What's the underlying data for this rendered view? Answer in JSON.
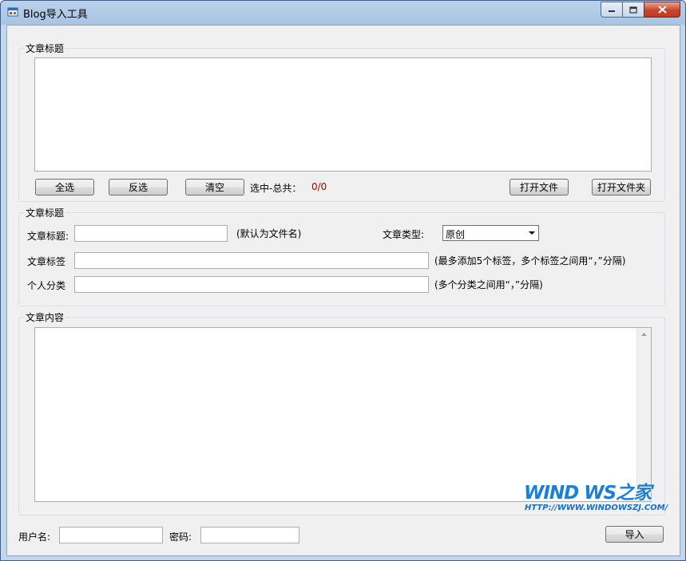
{
  "window": {
    "title": "Blog导入工具"
  },
  "file_group": {
    "label": "文章标题",
    "buttons": {
      "select_all": "全选",
      "invert": "反选",
      "clear": "清空",
      "open_file": "打开文件",
      "open_folder": "打开文件夹"
    },
    "selection_label": "选中-总共：",
    "selection_count": "0/0"
  },
  "meta_group": {
    "label": "文章标题",
    "title_label": "文章标题:",
    "title_value": "",
    "title_hint": "(默认为文件名)",
    "type_label": "文章类型:",
    "type_selected": "原创",
    "tags_label": "文章标签",
    "tags_value": "",
    "tags_hint": "(最多添加5个标签，多个标签之间用“，”分隔)",
    "category_label": "个人分类",
    "category_value": "",
    "category_hint": "(多个分类之间用“，”分隔)"
  },
  "content_group": {
    "label": "文章内容",
    "content_value": ""
  },
  "login": {
    "username_label": "用户名:",
    "username_value": "",
    "password_label": "密码:",
    "password_value": "",
    "import_button": "导入"
  },
  "watermark": {
    "brand": "WIND WS之家",
    "url": "HTTP://WWW.WINDOWSZJ.COM/"
  },
  "colors": {
    "count_color": "#b00000",
    "watermark_blue": "#1a7fd6"
  },
  "icons": [
    "app-icon",
    "minimize-icon",
    "maximize-icon",
    "close-icon",
    "dropdown-arrow-icon",
    "scroll-up-arrow-icon"
  ]
}
